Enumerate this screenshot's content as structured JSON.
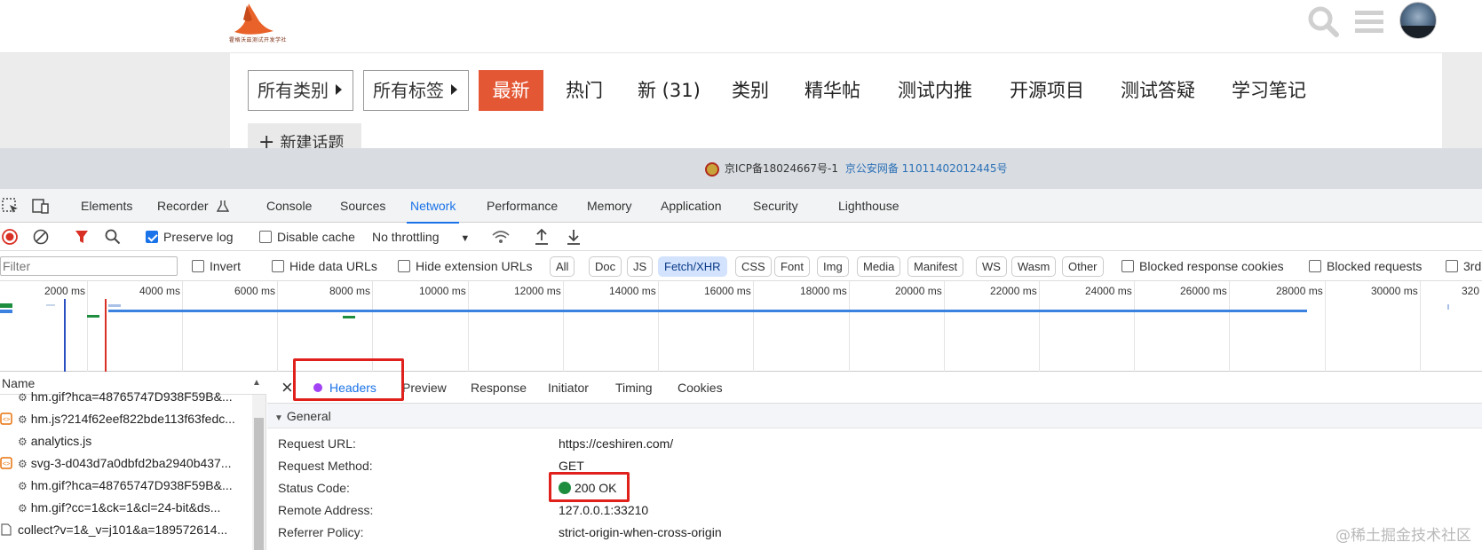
{
  "site": {
    "logo_text": "霍格沃兹测试开发学社",
    "filters": {
      "category_label": "所有类别",
      "tag_label": "所有标签"
    },
    "nav": {
      "latest": "最新",
      "hot": "热门",
      "new": "新 (31)",
      "categories": "类别",
      "featured": "精华帖",
      "referral": "测试内推",
      "opensource": "开源项目",
      "qa": "测试答疑",
      "notes": "学习笔记"
    },
    "new_topic_label": "新建话题",
    "accent_color": "#e45735"
  },
  "icp": {
    "record": "京ICP备18024667号-1",
    "police": "京公安网备 11011402012445号"
  },
  "devtools": {
    "tabs": [
      "Elements",
      "Recorder",
      "Console",
      "Sources",
      "Network",
      "Performance",
      "Memory",
      "Application",
      "Security",
      "Lighthouse"
    ],
    "active_tab": "Network",
    "toolbar": {
      "preserve_log": "Preserve log",
      "disable_cache": "Disable cache",
      "throttling": "No throttling"
    },
    "filter": {
      "placeholder": "Filter",
      "invert": "Invert",
      "hide_data_urls": "Hide data URLs",
      "hide_extension_urls": "Hide extension URLs",
      "types": [
        "All",
        "Doc",
        "JS",
        "Fetch/XHR",
        "CSS",
        "Font",
        "Img",
        "Media",
        "Manifest",
        "WS",
        "Wasm",
        "Other"
      ],
      "selected_type": "Fetch/XHR",
      "blocked_cookies": "Blocked response cookies",
      "blocked_requests": "Blocked requests",
      "third_party": "3rd"
    },
    "timeline_ticks": [
      "2000 ms",
      "4000 ms",
      "6000 ms",
      "8000 ms",
      "10000 ms",
      "12000 ms",
      "14000 ms",
      "16000 ms",
      "18000 ms",
      "20000 ms",
      "22000 ms",
      "24000 ms",
      "26000 ms",
      "28000 ms",
      "30000 ms",
      "320"
    ],
    "requests": {
      "column_name": "Name",
      "rows": [
        "hm.gif?hca=48765747D938F59B&...",
        "hm.js?214f62eef822bde113f63fedc...",
        "analytics.js",
        "svg-3-d043d7a0dbfd2ba2940b437...",
        "hm.gif?hca=48765747D938F59B&...",
        "hm.gif?cc=1&ck=1&cl=24-bit&ds...",
        "collect?v=1&_v=j101&a=189572614..."
      ]
    },
    "details": {
      "tabs": [
        "Headers",
        "Preview",
        "Response",
        "Initiator",
        "Timing",
        "Cookies"
      ],
      "active_tab": "Headers",
      "section": "General",
      "fields": [
        {
          "key": "Request URL:",
          "value": "https://ceshiren.com/"
        },
        {
          "key": "Request Method:",
          "value": "GET"
        },
        {
          "key": "Status Code:",
          "value": "200 OK"
        },
        {
          "key": "Remote Address:",
          "value": "127.0.0.1:33210"
        },
        {
          "key": "Referrer Policy:",
          "value": "strict-origin-when-cross-origin"
        }
      ]
    }
  },
  "watermark": "@稀土掘金技术社区"
}
